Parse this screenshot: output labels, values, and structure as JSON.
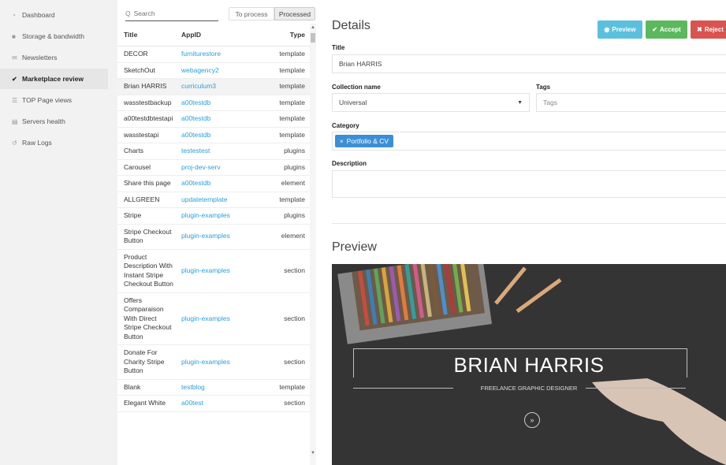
{
  "sidebar": {
    "items": [
      {
        "label": "Dashboard",
        "icon": "dashboard-icon",
        "glyph": "◔",
        "active": false
      },
      {
        "label": "Storage & bandwidth",
        "icon": "storage-icon",
        "glyph": "■",
        "active": false
      },
      {
        "label": "Newsletters",
        "icon": "envelope-icon",
        "glyph": "✉",
        "active": false
      },
      {
        "label": "Marketplace review",
        "icon": "check-icon",
        "glyph": "✔",
        "active": true
      },
      {
        "label": "TOP Page views",
        "icon": "list-icon",
        "glyph": "☰",
        "active": false
      },
      {
        "label": "Servers health",
        "icon": "server-icon",
        "glyph": "▤",
        "active": false
      },
      {
        "label": "Raw Logs",
        "icon": "history-icon",
        "glyph": "↺",
        "active": false
      }
    ]
  },
  "list": {
    "search": {
      "placeholder": "Search",
      "icon": "search-icon",
      "glyph": "Q"
    },
    "toggle": {
      "to_process": "To process",
      "processed": "Processed",
      "active": "processed"
    },
    "columns": {
      "title": "Title",
      "appid": "AppID",
      "type": "Type"
    },
    "rows": [
      {
        "title": "DECOR",
        "appid": "furniturestore",
        "type": "template"
      },
      {
        "title": "SketchOut",
        "appid": "webagency2",
        "type": "template"
      },
      {
        "title": "Brian HARRIS",
        "appid": "curriculum3",
        "type": "template",
        "selected": true
      },
      {
        "title": "wasstestbackup",
        "appid": "a00testdb",
        "type": "template"
      },
      {
        "title": "a00testdbtestapi",
        "appid": "a00testdb",
        "type": "template"
      },
      {
        "title": "wasstestapi",
        "appid": "a00testdb",
        "type": "template"
      },
      {
        "title": "Charts",
        "appid": "testestest",
        "type": "plugins"
      },
      {
        "title": "Carousel",
        "appid": "proj-dev-serv",
        "type": "plugins"
      },
      {
        "title": "Share this page",
        "appid": "a00testdb",
        "type": "element"
      },
      {
        "title": "ALLGREEN",
        "appid": "updatetemplate",
        "type": "template"
      },
      {
        "title": "Stripe",
        "appid": "plugin-examples",
        "type": "plugins"
      },
      {
        "title": "Stripe Checkout Button",
        "appid": "plugin-examples",
        "type": "element"
      },
      {
        "title": "Product Description With Instant Stripe Checkout Button",
        "appid": "plugin-examples",
        "type": "section"
      },
      {
        "title": "Offers Comparaison With Direct Stripe Checkout Button",
        "appid": "plugin-examples",
        "type": "section"
      },
      {
        "title": "Donate For Charity Stripe Button",
        "appid": "plugin-examples",
        "type": "section"
      },
      {
        "title": "Blank",
        "appid": "testblog",
        "type": "template"
      },
      {
        "title": "Elegant White",
        "appid": "a00test",
        "type": "section"
      }
    ]
  },
  "details": {
    "heading": "Details",
    "buttons": {
      "preview": "Preview",
      "accept": "Accept",
      "reject": "Reject"
    },
    "title_label": "Title",
    "title_value": "Brian HARRIS",
    "collection_label": "Collection name",
    "collection_value": "Universal",
    "tags_label": "Tags",
    "tags_placeholder": "Tags",
    "category_label": "Category",
    "category_chip": "Portfolio & CV",
    "description_label": "Description",
    "description_value": "",
    "preview_heading": "Preview",
    "preview_name": "BRIAN HARRIS",
    "preview_subtitle": "FREELANCE GRAPHIC DESIGNER",
    "colors": {
      "preview": "#5bc0de",
      "accept": "#5cb85c",
      "reject": "#d9534f",
      "link": "#2a9fd6",
      "chip": "#3c8fd6"
    }
  }
}
